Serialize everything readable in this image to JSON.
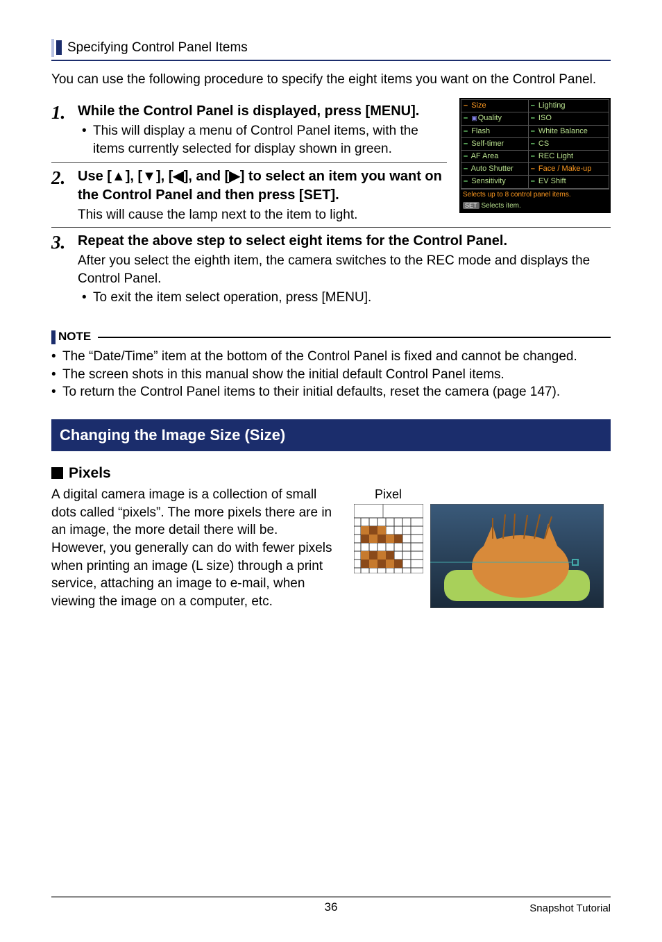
{
  "section_heading": "Specifying Control Panel Items",
  "intro": "You can use the following procedure to specify the eight items you want on the Control Panel.",
  "steps": {
    "s1": {
      "num": "1.",
      "title": "While the Control Panel is displayed, press [MENU].",
      "bullet": "This will display a menu of Control Panel items, with the items currently selected for display shown in green."
    },
    "s2": {
      "num": "2.",
      "title_prefix": "Use [",
      "title_mid1": "], [",
      "title_mid2": "], [",
      "title_mid3": "], and [",
      "title_suffix": "] to select an item you want on the Control Panel and then press [SET].",
      "text": "This will cause the lamp next to the item to light."
    },
    "s3": {
      "num": "3.",
      "title": "Repeat the above step to select eight items for the Control Panel.",
      "text": "After you select the eighth item, the camera switches to the REC mode and displays the Control Panel.",
      "bullet": "To exit the item select operation, press [MENU]."
    }
  },
  "screenshot": {
    "rows": [
      [
        "Size",
        "Lighting",
        true,
        false
      ],
      [
        "Quality",
        "ISO",
        false,
        false
      ],
      [
        "Flash",
        "White Balance",
        false,
        false
      ],
      [
        "Self-timer",
        "CS",
        false,
        false
      ],
      [
        "AF Area",
        "REC Light",
        false,
        false
      ],
      [
        "Auto Shutter",
        "Face / Make-up",
        false,
        true
      ],
      [
        "Sensitivity",
        "EV Shift",
        false,
        false
      ]
    ],
    "footer1": "Selects up to 8 control panel items.",
    "footer2_btn": "SET",
    "footer2_text": "Selects item."
  },
  "note": {
    "label": "NOTE",
    "items": [
      "The “Date/Time” item at the bottom of the Control Panel is fixed and cannot be changed.",
      "The screen shots in this manual show the initial default Control Panel items.",
      "To return the Control Panel items to their initial defaults, reset the camera (page 147)."
    ]
  },
  "blue_heading": "Changing the Image Size (Size)",
  "pixels": {
    "heading": "Pixels",
    "label": "Pixel",
    "text": "A digital camera image is a collection of small dots called “pixels”. The more pixels there are in an image, the more detail there will be. However, you generally can do with fewer pixels when printing an image (L size) through a print service, attaching an image to e-mail, when viewing the image on a computer, etc."
  },
  "footer": {
    "page": "36",
    "right": "Snapshot Tutorial"
  }
}
